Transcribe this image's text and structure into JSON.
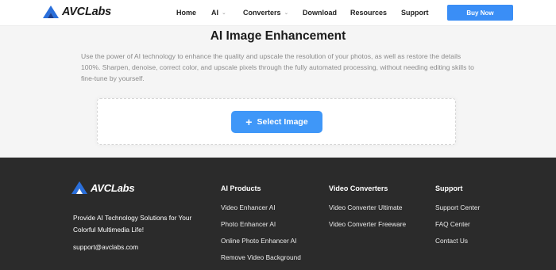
{
  "header": {
    "logo_text": "AVCLabs",
    "nav": [
      {
        "label": "Home",
        "has_dropdown": false
      },
      {
        "label": "AI",
        "has_dropdown": true
      },
      {
        "label": "Converters",
        "has_dropdown": true
      },
      {
        "label": "Download",
        "has_dropdown": false
      },
      {
        "label": "Resources",
        "has_dropdown": false
      },
      {
        "label": "Support",
        "has_dropdown": false
      }
    ],
    "buy_label": "Buy Now"
  },
  "main": {
    "title": "AI Image Enhancement",
    "description": "Use the power of AI technology to enhance the quality and upscale the resolution of your photos, as well as restore the details 100%. Sharpen, denoise, correct color, and upscale pixels through the fully automated processing, without needing editing skills to fine-tune by yourself.",
    "select_label": "Select Image"
  },
  "footer": {
    "logo_text": "AVCLabs",
    "tagline": "Provide AI Technology Solutions for Your Colorful Multimedia Life!",
    "email": "support@avclabs.com",
    "columns": [
      {
        "title": "AI Products",
        "links": [
          "Video Enhancer AI",
          "Photo Enhancer AI",
          "Online Photo Enhancer AI",
          "Remove Video Background"
        ]
      },
      {
        "title": "Video Converters",
        "links": [
          "Video Converter Ultimate",
          "Video Converter Freeware"
        ]
      },
      {
        "title": "Support",
        "links": [
          "Support Center",
          "FAQ Center",
          "Contact Us"
        ]
      }
    ]
  },
  "colors": {
    "accent": "#3a8ef6",
    "logo_blue": "#2a6fdb",
    "footer_bg": "#2b2b2b",
    "page_bg": "#f5f5f5"
  },
  "icons": {
    "logo": "avclabs-logo-icon",
    "dropdown": "chevron-down-icon",
    "plus": "plus-icon"
  }
}
